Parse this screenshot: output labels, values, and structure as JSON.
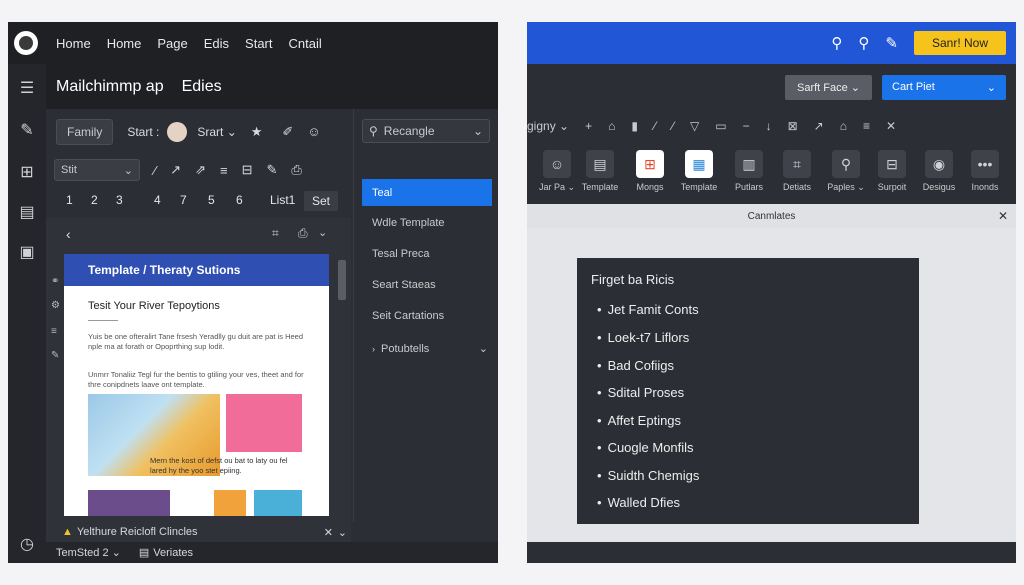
{
  "left": {
    "nav": [
      "Home",
      "Home",
      "Page",
      "Edis",
      "Start",
      "Cntail"
    ],
    "header": {
      "app": "Mailchimmp ap",
      "section": "Edies"
    },
    "toolbar1": {
      "family": "Family",
      "start": "Start :",
      "srart": "Srart ⌄"
    },
    "toolbar2": {
      "select": "Stit"
    },
    "pages": [
      "1",
      "2",
      "3",
      "4",
      "7",
      "5",
      "6",
      "List1"
    ],
    "set_label": "Set",
    "card": {
      "header": "Template / Theraty Sutions",
      "title": "Tesit Your River Tepoytions",
      "para1": "Yuis be one ofteralirt Tane frsesh Yeradlly gu duit are pat is Heed nple ma at forath or Opoprthing sup lodit.",
      "para2": "Unmrr Tonaliiz Tegl fur the bentis to gtiling your ves, theet and for thre conipdnets laave ont template.",
      "caption": "Mern the kost of defst ou bat to laty ou fel lared hy the yoo stet epiing."
    },
    "footer1": "Yelthure Reiclofl Clincles",
    "footer2": {
      "left": "TemSted 2 ⌄",
      "right": "Veriates"
    },
    "sidebar": {
      "search": "Recangle",
      "items": [
        "Teal",
        "Wdle Template",
        "Tesal Preca",
        "Seart Staeas",
        "Seit Cartations",
        "Potubtells"
      ]
    }
  },
  "right": {
    "cta": "Sanr! Now",
    "btn_gray": "Sarft Face ⌄",
    "btn_blue": "Cart Piet",
    "toolbar_label": "gigny ⌄",
    "ribbon": [
      "Jar Pa ⌄",
      "Template",
      "Mongs",
      "Template",
      "Putlars",
      "Detiats",
      "Paples ⌄",
      "Surpoit",
      "Desigus",
      "Inonds"
    ],
    "tab_title": "Canmlates",
    "panel": {
      "title": "Firget ba Ricis",
      "items": [
        "Jet Famit Conts",
        "Loek-t7 Liflors",
        "Bad Cofiigs",
        "Sdital Proses",
        "Affet Eptings",
        "Cuogle Monfils",
        "Suidth Chemigs",
        "Walled Dfies"
      ]
    }
  }
}
